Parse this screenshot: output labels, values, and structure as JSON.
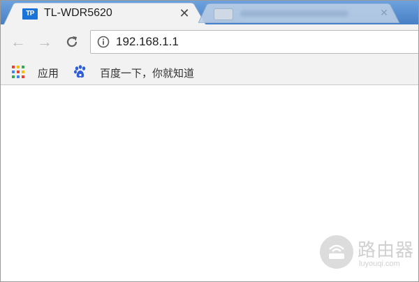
{
  "tabs": [
    {
      "favicon": "TP",
      "title": "TL-WDR5620",
      "close": "✕",
      "active": true
    }
  ],
  "toolbar": {
    "back_icon": "←",
    "forward_icon": "→",
    "reload_icon": "C",
    "url": "192.168.1.1"
  },
  "bookmarks": [
    {
      "label": "应用",
      "icon": "apps-grid-icon"
    },
    {
      "label": "百度一下，你就知道",
      "icon": "baidu-paw-icon"
    }
  ],
  "watermark": {
    "title": "路由器",
    "subtitle": "luyouqi.com"
  },
  "colors": {
    "tab_strip": "#4d88c9",
    "toolbar": "#f2f2f2",
    "favicon_bg": "#1a73d9",
    "baidu_blue": "#2e5fd8"
  }
}
